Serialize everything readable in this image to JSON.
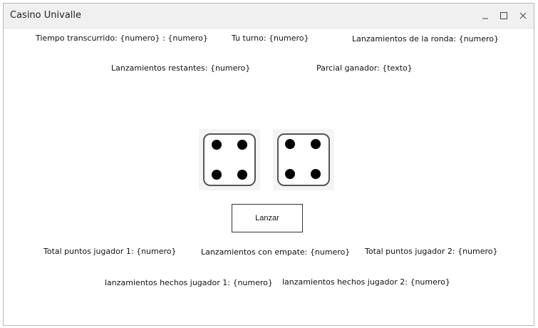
{
  "window": {
    "title": "Casino Univalle",
    "controls": {
      "minimize": "_",
      "maximize": "□",
      "close": "✕"
    }
  },
  "stats_top": {
    "elapsed_time": "Tiempo transcurrido: {numero} : {numero}",
    "your_turn": "Tu turno: {numero}",
    "round_throws": "Lanzamientos de la ronda: {numero}",
    "remaining_throws": "Lanzamientos restantes: {numero}",
    "partial_winner": "Parcial ganador: {texto}"
  },
  "dice": [
    {
      "value": 4,
      "icon": "dice-four-icon"
    },
    {
      "value": 4,
      "icon": "dice-four-icon"
    }
  ],
  "actions": {
    "roll_label": "Lanzar"
  },
  "stats_bottom": {
    "total_points_p1": "Total puntos jugador 1: {numero}",
    "tie_throws": "Lanzamientos con empate: {numero}",
    "total_points_p2": "Total puntos jugador 2: {numero}",
    "throws_p1": "lanzamientos hechos jugador 1: {numero}",
    "throws_p2": "lanzamientos hechos jugador 2: {numero}"
  }
}
